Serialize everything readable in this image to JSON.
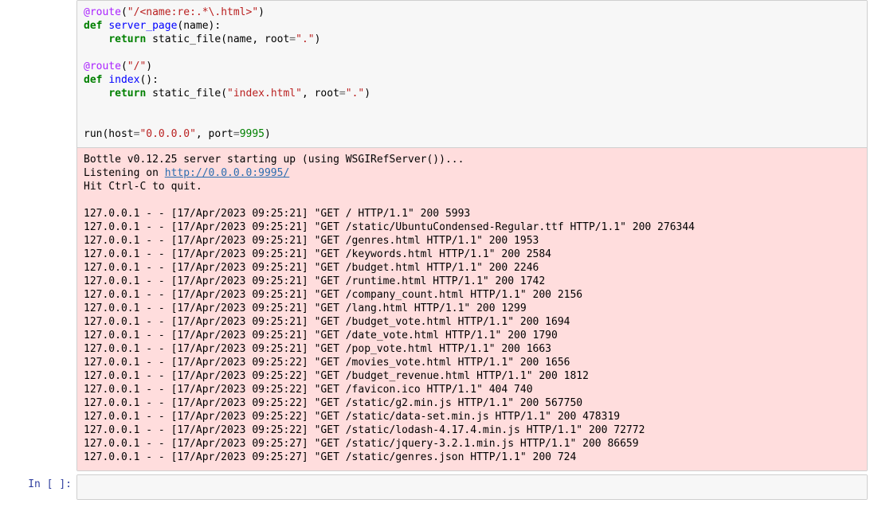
{
  "prompt": {
    "empty": "In [ ]:"
  },
  "code": {
    "l1_dec": "@route",
    "l1_arg": "\"/<name:re:.*\\.html>\"",
    "l2_def": "def",
    "l2_fn": "server_page",
    "l2_params": "(name):",
    "l3_ret": "return",
    "l3_call": "static_file(name, root",
    "l3_eq": "=",
    "l3_dot": "\".\"",
    "l3_close": ")",
    "l5_dec": "@route",
    "l5_arg": "\"/\"",
    "l6_def": "def",
    "l6_fn": "index",
    "l6_params": "():",
    "l7_ret": "return",
    "l7_call": "static_file(",
    "l7_idx": "\"index.html\"",
    "l7_mid": ", root",
    "l7_eq": "=",
    "l7_dot": "\".\"",
    "l7_close": ")",
    "l10_run": "run(host",
    "l10_eq1": "=",
    "l10_host": "\"0.0.0.0\"",
    "l10_mid": ", port",
    "l10_eq2": "=",
    "l10_port": "9995",
    "l10_close": ")"
  },
  "output": {
    "line1": "Bottle v0.12.25 server starting up (using WSGIRefServer())...",
    "line2_pre": "Listening on ",
    "line2_url": "http://0.0.0.0:9995/",
    "line3": "Hit Ctrl-C to quit.",
    "log_lines": [
      "127.0.0.1 - - [17/Apr/2023 09:25:21] \"GET / HTTP/1.1\" 200 5993",
      "127.0.0.1 - - [17/Apr/2023 09:25:21] \"GET /static/UbuntuCondensed-Regular.ttf HTTP/1.1\" 200 276344",
      "127.0.0.1 - - [17/Apr/2023 09:25:21] \"GET /genres.html HTTP/1.1\" 200 1953",
      "127.0.0.1 - - [17/Apr/2023 09:25:21] \"GET /keywords.html HTTP/1.1\" 200 2584",
      "127.0.0.1 - - [17/Apr/2023 09:25:21] \"GET /budget.html HTTP/1.1\" 200 2246",
      "127.0.0.1 - - [17/Apr/2023 09:25:21] \"GET /runtime.html HTTP/1.1\" 200 1742",
      "127.0.0.1 - - [17/Apr/2023 09:25:21] \"GET /company_count.html HTTP/1.1\" 200 2156",
      "127.0.0.1 - - [17/Apr/2023 09:25:21] \"GET /lang.html HTTP/1.1\" 200 1299",
      "127.0.0.1 - - [17/Apr/2023 09:25:21] \"GET /budget_vote.html HTTP/1.1\" 200 1694",
      "127.0.0.1 - - [17/Apr/2023 09:25:21] \"GET /date_vote.html HTTP/1.1\" 200 1790",
      "127.0.0.1 - - [17/Apr/2023 09:25:21] \"GET /pop_vote.html HTTP/1.1\" 200 1663",
      "127.0.0.1 - - [17/Apr/2023 09:25:22] \"GET /movies_vote.html HTTP/1.1\" 200 1656",
      "127.0.0.1 - - [17/Apr/2023 09:25:22] \"GET /budget_revenue.html HTTP/1.1\" 200 1812",
      "127.0.0.1 - - [17/Apr/2023 09:25:22] \"GET /favicon.ico HTTP/1.1\" 404 740",
      "127.0.0.1 - - [17/Apr/2023 09:25:22] \"GET /static/g2.min.js HTTP/1.1\" 200 567750",
      "127.0.0.1 - - [17/Apr/2023 09:25:22] \"GET /static/data-set.min.js HTTP/1.1\" 200 478319",
      "127.0.0.1 - - [17/Apr/2023 09:25:22] \"GET /static/lodash-4.17.4.min.js HTTP/1.1\" 200 72772",
      "127.0.0.1 - - [17/Apr/2023 09:25:27] \"GET /static/jquery-3.2.1.min.js HTTP/1.1\" 200 86659",
      "127.0.0.1 - - [17/Apr/2023 09:25:27] \"GET /static/genres.json HTTP/1.1\" 200 724"
    ]
  }
}
